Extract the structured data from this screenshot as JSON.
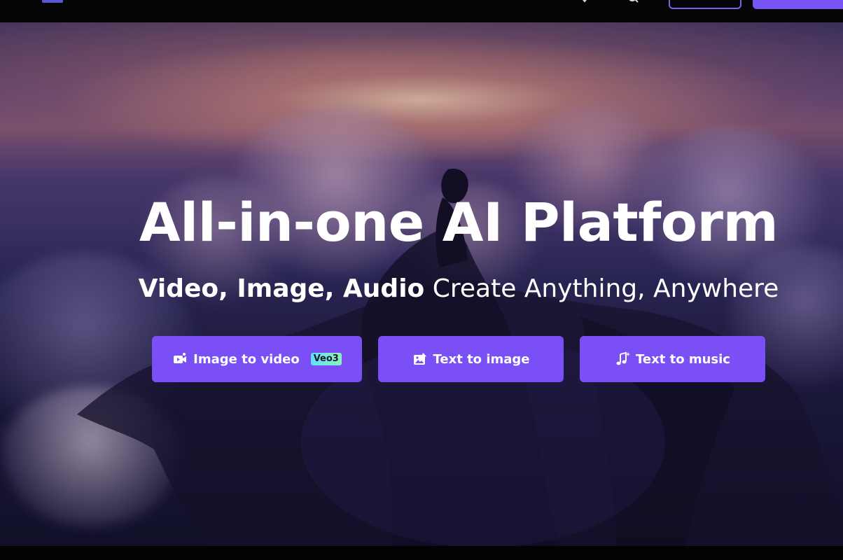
{
  "hero": {
    "title": "All-in-one AI Platform",
    "subtitle_strong": "Video, Image, Audio",
    "subtitle_light": "Create Anything, Anywhere"
  },
  "cta_buttons": [
    {
      "label": "Image to video",
      "icon": "video-camera-icon",
      "badge": "Veo3"
    },
    {
      "label": "Text to image",
      "icon": "image-edit-icon"
    },
    {
      "label": "Text to music",
      "icon": "music-note-icon"
    }
  ],
  "colors": {
    "accent": "#7a4ff6",
    "badge_gradient_start": "#5fe0ff",
    "badge_gradient_end": "#8ef0b8",
    "nav_outline": "#7b63f2"
  }
}
